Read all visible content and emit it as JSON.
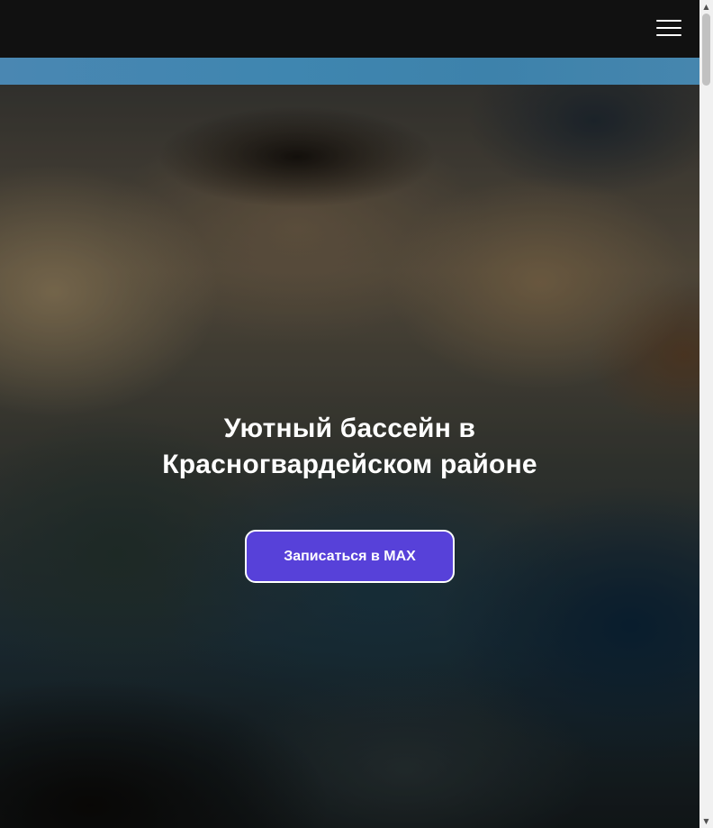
{
  "header": {
    "menu_icon": "hamburger-menu-icon"
  },
  "hero": {
    "title_line1": "Уютный бассейн в",
    "title_line2": "Красногвардейском районе",
    "cta_label": "Записаться в MAX"
  },
  "colors": {
    "topbar": "#111111",
    "stripe": "#3f86b0",
    "cta_background": "#5741d9",
    "cta_border": "#ffffff"
  },
  "scrollbar": {
    "up_icon": "scroll-up-arrow-icon",
    "down_icon": "scroll-down-arrow-icon"
  }
}
